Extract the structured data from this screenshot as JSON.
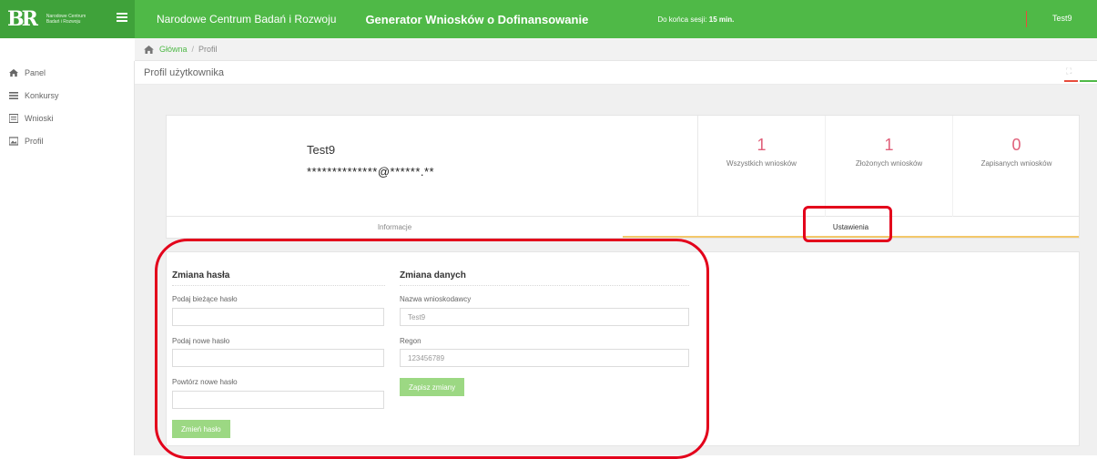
{
  "header": {
    "logo_mark": "BR",
    "logo_text": "Narodowe Centrum Badań i Rozwoju",
    "org_name": "Narodowe Centrum Badań i Rozwoju",
    "app_title": "Generator Wniosków o Dofinansowanie",
    "session_label": "Do końca sesji:",
    "session_value": "15 min.",
    "user": "Test9"
  },
  "breadcrumb": {
    "home": "Główna",
    "separator": "/",
    "current": "Profil"
  },
  "sidebar": {
    "items": [
      {
        "label": "Panel",
        "icon": "home-icon"
      },
      {
        "label": "Konkursy",
        "icon": "list-icon"
      },
      {
        "label": "Wnioski",
        "icon": "document-icon"
      },
      {
        "label": "Profil",
        "icon": "image-icon"
      }
    ]
  },
  "page": {
    "title": "Profil użytkownika",
    "expand_icon": "expand-icon"
  },
  "profile": {
    "name": "Test9",
    "email": "**************@******.**"
  },
  "stats": [
    {
      "value": "1",
      "label": "Wszystkich wniosków"
    },
    {
      "value": "1",
      "label": "Złożonych wniosków"
    },
    {
      "value": "0",
      "label": "Zapisanych wniosków"
    }
  ],
  "tabs": [
    {
      "label": "Informacje",
      "active": false
    },
    {
      "label": "Ustawienia",
      "active": true
    }
  ],
  "password_change": {
    "title": "Zmiana hasła",
    "current_label": "Podaj bieżące hasło",
    "current_value": "",
    "new_label": "Podaj nowe hasło",
    "new_value": "",
    "repeat_label": "Powtórz nowe hasło",
    "repeat_value": "",
    "submit_label": "Zmień hasło"
  },
  "data_change": {
    "title": "Zmiana danych",
    "name_label": "Nazwa wnioskodawcy",
    "name_value": "Test9",
    "regon_label": "Regon",
    "regon_value": "123456789",
    "submit_label": "Zapisz zmiany"
  },
  "colors": {
    "brand_green": "#4fb947",
    "stat_pink": "#e0607a",
    "button_green": "#9cd883",
    "annotation_red": "#e3001b",
    "tab_active_underline": "#f3c86a"
  }
}
